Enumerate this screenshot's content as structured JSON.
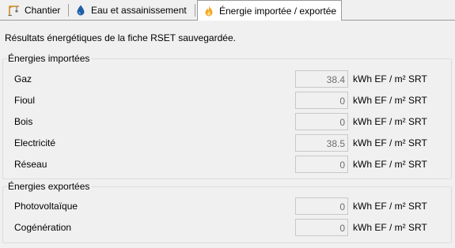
{
  "tabs": [
    {
      "label": "Chantier",
      "icon": "crane-icon",
      "active": false
    },
    {
      "label": "Eau et assainissement",
      "icon": "water-drop-icon",
      "active": false
    },
    {
      "label": "Énergie importée / exportée",
      "icon": "flame-icon",
      "active": true
    }
  ],
  "intro": "Résultats énergétiques de la fiche RSET sauvegardée.",
  "imported": {
    "title": "Énergies importées",
    "rows": [
      {
        "label": "Gaz",
        "value": "38.4",
        "unit": "kWh EF / m² SRT"
      },
      {
        "label": "Fioul",
        "value": "0",
        "unit": "kWh EF / m² SRT"
      },
      {
        "label": "Bois",
        "value": "0",
        "unit": "kWh EF / m² SRT"
      },
      {
        "label": "Electricité",
        "value": "38.5",
        "unit": "kWh EF / m² SRT"
      },
      {
        "label": "Réseau",
        "value": "0",
        "unit": "kWh EF / m² SRT"
      }
    ]
  },
  "exported": {
    "title": "Énergies exportées",
    "rows": [
      {
        "label": "Photovoltaïque",
        "value": "0",
        "unit": "kWh EF / m² SRT"
      },
      {
        "label": "Cogénération",
        "value": "0",
        "unit": "kWh EF / m² SRT"
      }
    ]
  },
  "colors": {
    "background": "#f0f0f0",
    "field_text": "#6d6d6d",
    "field_border": "#c8c8c8",
    "flame": "#f5a623"
  }
}
